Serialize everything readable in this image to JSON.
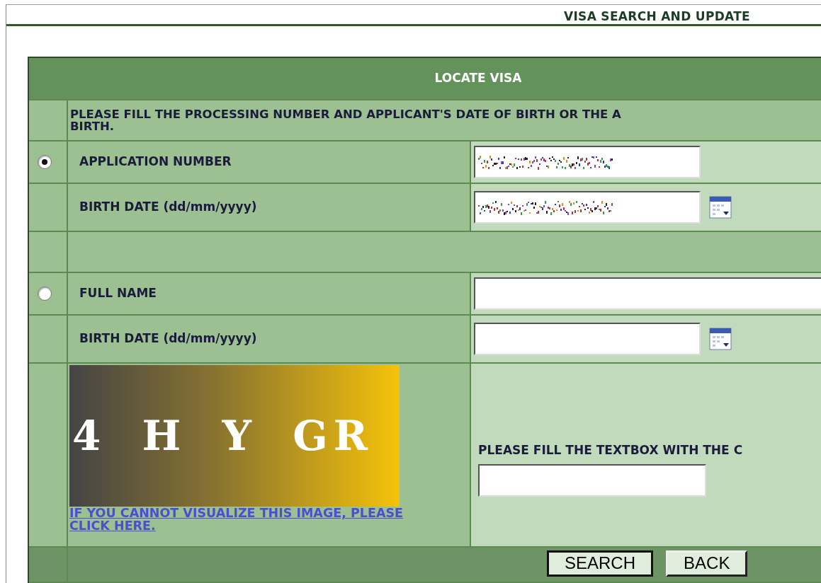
{
  "page_title": "VISA SEARCH AND UPDATE",
  "form": {
    "title": "LOCATE VISA",
    "instructions": [
      "PLEASE FILL THE PROCESSING NUMBER AND APPLICANT'S DATE OF BIRTH OR THE A",
      "BIRTH."
    ],
    "options": [
      {
        "selected": true,
        "fields": [
          {
            "label": "APPLICATION NUMBER",
            "kind": "number",
            "obscured": true
          },
          {
            "label": "BIRTH DATE (dd/mm/yyyy)",
            "kind": "date",
            "obscured": true
          }
        ]
      },
      {
        "selected": false,
        "fields": [
          {
            "label": "FULL NAME",
            "kind": "text",
            "obscured": false
          },
          {
            "label": "BIRTH DATE (dd/mm/yyyy)",
            "kind": "date",
            "obscured": false
          }
        ]
      }
    ],
    "captcha": {
      "code": "4 H Y GR",
      "help_link": "IF YOU CANNOT VISUALIZE THIS IMAGE, PLEASE CLICK HERE.",
      "prompt": "PLEASE FILL THE TEXTBOX WITH THE C"
    },
    "buttons": [
      "SEARCH",
      "BACK"
    ]
  }
}
